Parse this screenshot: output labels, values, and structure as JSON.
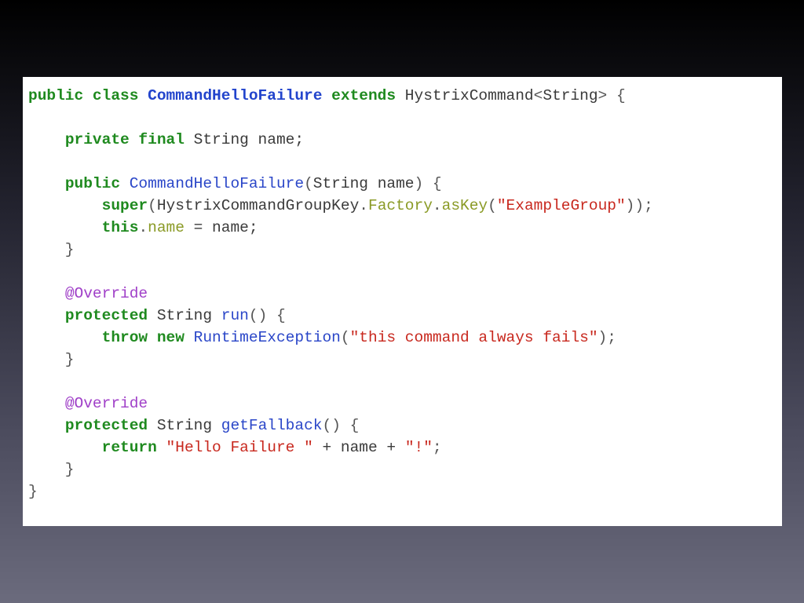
{
  "colors": {
    "keyword": "#1f8a1f",
    "class_name": "#2244cc",
    "method": "#2a46c8",
    "plain": "#3a3a3a",
    "field": "#8a9a25",
    "string": "#c8281e",
    "annotation": "#a040c8"
  },
  "code": {
    "lines": [
      [
        {
          "t": "public class ",
          "c": "kw"
        },
        {
          "t": "CommandHelloFailure",
          "c": "type"
        },
        {
          "t": " ",
          "c": "plain"
        },
        {
          "t": "extends",
          "c": "kw"
        },
        {
          "t": " HystrixCommand",
          "c": "plain"
        },
        {
          "t": "<",
          "c": "punct"
        },
        {
          "t": "String",
          "c": "plain"
        },
        {
          "t": "> {",
          "c": "punct"
        }
      ],
      [],
      [
        {
          "t": "    ",
          "c": "plain"
        },
        {
          "t": "private final",
          "c": "kw"
        },
        {
          "t": " String name;",
          "c": "plain"
        }
      ],
      [],
      [
        {
          "t": "    ",
          "c": "plain"
        },
        {
          "t": "public",
          "c": "kw"
        },
        {
          "t": " ",
          "c": "plain"
        },
        {
          "t": "CommandHelloFailure",
          "c": "meth"
        },
        {
          "t": "(",
          "c": "punct"
        },
        {
          "t": "String name",
          "c": "plain"
        },
        {
          "t": ") {",
          "c": "punct"
        }
      ],
      [
        {
          "t": "        ",
          "c": "plain"
        },
        {
          "t": "super",
          "c": "kw"
        },
        {
          "t": "(",
          "c": "punct"
        },
        {
          "t": "HystrixCommandGroupKey",
          "c": "plain"
        },
        {
          "t": ".",
          "c": "punct"
        },
        {
          "t": "Factory",
          "c": "fld"
        },
        {
          "t": ".",
          "c": "punct"
        },
        {
          "t": "asKey",
          "c": "fld"
        },
        {
          "t": "(",
          "c": "punct"
        },
        {
          "t": "\"ExampleGroup\"",
          "c": "str"
        },
        {
          "t": "));",
          "c": "punct"
        }
      ],
      [
        {
          "t": "        ",
          "c": "plain"
        },
        {
          "t": "this",
          "c": "kw"
        },
        {
          "t": ".",
          "c": "punct"
        },
        {
          "t": "name",
          "c": "fld"
        },
        {
          "t": " = name;",
          "c": "plain"
        }
      ],
      [
        {
          "t": "    }",
          "c": "punct"
        }
      ],
      [],
      [
        {
          "t": "    ",
          "c": "plain"
        },
        {
          "t": "@Override",
          "c": "anno"
        }
      ],
      [
        {
          "t": "    ",
          "c": "plain"
        },
        {
          "t": "protected",
          "c": "kw"
        },
        {
          "t": " String ",
          "c": "plain"
        },
        {
          "t": "run",
          "c": "meth"
        },
        {
          "t": "() {",
          "c": "punct"
        }
      ],
      [
        {
          "t": "        ",
          "c": "plain"
        },
        {
          "t": "throw new",
          "c": "kw"
        },
        {
          "t": " ",
          "c": "plain"
        },
        {
          "t": "RuntimeException",
          "c": "meth"
        },
        {
          "t": "(",
          "c": "punct"
        },
        {
          "t": "\"this command always fails\"",
          "c": "str"
        },
        {
          "t": ");",
          "c": "punct"
        }
      ],
      [
        {
          "t": "    }",
          "c": "punct"
        }
      ],
      [],
      [
        {
          "t": "    ",
          "c": "plain"
        },
        {
          "t": "@Override",
          "c": "anno"
        }
      ],
      [
        {
          "t": "    ",
          "c": "plain"
        },
        {
          "t": "protected",
          "c": "kw"
        },
        {
          "t": " String ",
          "c": "plain"
        },
        {
          "t": "getFallback",
          "c": "meth"
        },
        {
          "t": "() {",
          "c": "punct"
        }
      ],
      [
        {
          "t": "        ",
          "c": "plain"
        },
        {
          "t": "return",
          "c": "kw"
        },
        {
          "t": " ",
          "c": "plain"
        },
        {
          "t": "\"Hello Failure \"",
          "c": "str"
        },
        {
          "t": " + name + ",
          "c": "plain"
        },
        {
          "t": "\"!\"",
          "c": "str"
        },
        {
          "t": ";",
          "c": "punct"
        }
      ],
      [
        {
          "t": "    }",
          "c": "punct"
        }
      ],
      [
        {
          "t": "}",
          "c": "punct"
        }
      ]
    ]
  }
}
